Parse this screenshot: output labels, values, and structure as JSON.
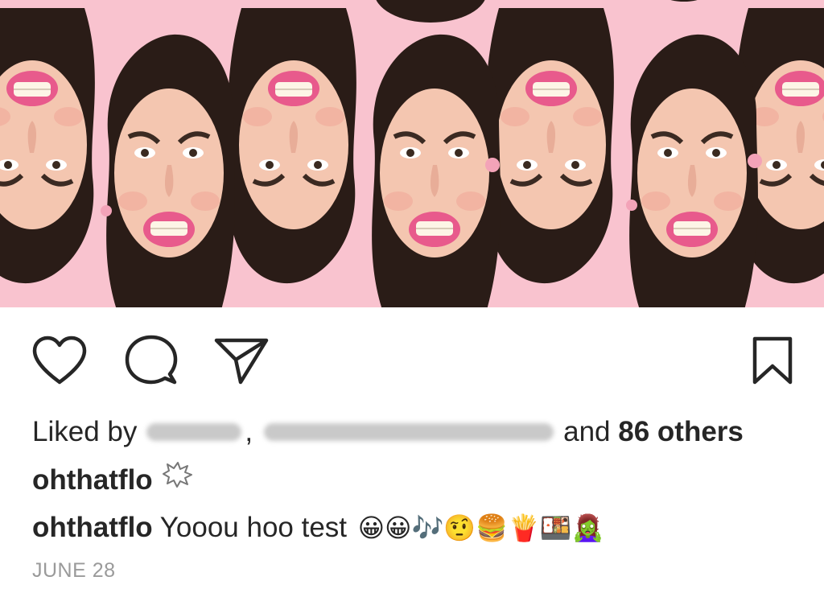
{
  "post": {
    "image": {
      "background_color": "#f9c3cf",
      "description_icon": "repeated-face-collage-image"
    },
    "actions": {
      "like_icon": "heart-icon",
      "comment_icon": "comment-bubble-icon",
      "share_icon": "paper-plane-icon",
      "save_icon": "bookmark-icon"
    },
    "likes": {
      "prefix": "Liked by",
      "comma": ",",
      "and_text": "and",
      "others_text": "86 others"
    },
    "caption": {
      "username": "ohthatflo",
      "emoji_icon": "burst-outline-icon"
    },
    "comment": {
      "username": "ohthatflo",
      "text": "Yooou hoo test",
      "emojis": "😀😀🎶🤨🍔🍟🍱🧟‍♀️"
    },
    "date": "JUNE 28",
    "colors": {
      "text": "#262626",
      "muted": "#9a9a9a"
    }
  }
}
